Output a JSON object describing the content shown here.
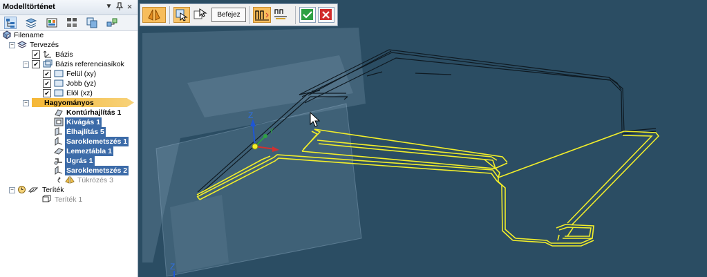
{
  "panel": {
    "title": "Modelltörténet",
    "buttons": {
      "dropdown": "▼",
      "pin": "ᵖ",
      "close": "×"
    }
  },
  "tree": {
    "filename": "Filename",
    "tervezes": "Tervezés",
    "bazis": "Bázis",
    "bazis_ref": "Bázis referenciasíkok",
    "felul": "Felül (xy)",
    "jobb": "Jobb (yz)",
    "elol": "Elöl (xz)",
    "hagyomanyos": "Hagyományos",
    "features": [
      {
        "label": "Kontúrhajlítás 1",
        "style": "bold"
      },
      {
        "label": "Kivágás 1",
        "style": "hl"
      },
      {
        "label": "Élhajlítás 5",
        "style": "hl"
      },
      {
        "label": "Saroklemetszés 1",
        "style": "hl"
      },
      {
        "label": "Lemeztábla 1",
        "style": "hl"
      },
      {
        "label": "Ugrás 1",
        "style": "hl"
      },
      {
        "label": "Saroklemetszés 2",
        "style": "hl"
      },
      {
        "label": "Tükrözés 3",
        "style": "grey"
      }
    ],
    "teritek": "Teríték",
    "teritek1": "Teríték 1"
  },
  "cmdbar": {
    "befejez": "Befejez"
  },
  "viewport": {
    "axis_z": "Z",
    "axis_y": "Y",
    "axis_z2": "Z",
    "colors": {
      "background": "#2b4d63",
      "highlight": "#f2ee2a",
      "edges": "#0f1a22"
    }
  }
}
